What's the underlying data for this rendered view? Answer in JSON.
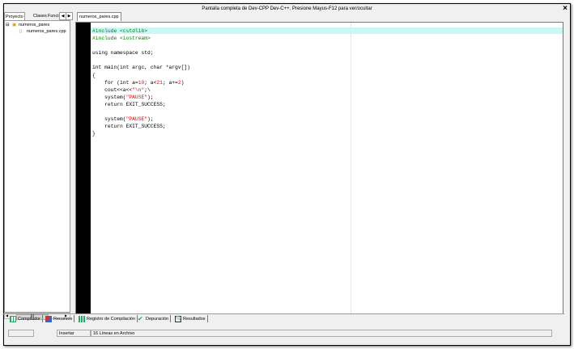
{
  "window": {
    "title": "Pantalla completa de Dev-CPP Dev-C++. Presione Mayus-F12 para ver/ocultar",
    "close": "×"
  },
  "left_panel": {
    "tabs": [
      "Proyecto",
      "Clases",
      "Funcic"
    ],
    "project_node": "numeros_pares",
    "file_node": "numeros_pares.cpp",
    "scroll_thumb_label": "III"
  },
  "editor": {
    "tab": "numeros_pares.cpp",
    "code": [
      [
        {
          "t": "#include <cstdlib>",
          "c": "pp"
        }
      ],
      [
        {
          "t": "#include <iostream>",
          "c": "pp"
        }
      ],
      [
        {
          "t": ""
        }
      ],
      [
        {
          "t": "using namespace std;"
        }
      ],
      [
        {
          "t": ""
        }
      ],
      [
        {
          "t": "int main(int argc, char *argv[])"
        }
      ],
      [
        {
          "t": "{"
        }
      ],
      [
        {
          "t": "    for (int a="
        },
        {
          "t": "10",
          "c": "num"
        },
        {
          "t": "; a<"
        },
        {
          "t": "21",
          "c": "num"
        },
        {
          "t": "; a+="
        },
        {
          "t": "2",
          "c": "num"
        },
        {
          "t": ")"
        }
      ],
      [
        {
          "t": "    cout<<a<<"
        },
        {
          "t": "\"\\n\"",
          "c": "str"
        },
        {
          "t": ";\\"
        }
      ],
      [
        {
          "t": "    system("
        },
        {
          "t": "\"PAUSE\"",
          "c": "str"
        },
        {
          "t": ");"
        }
      ],
      [
        {
          "t": "    return EXIT_SUCCESS;"
        }
      ],
      [
        {
          "t": ""
        }
      ],
      [
        {
          "t": "    system("
        },
        {
          "t": "\"PAUSE\"",
          "c": "str"
        },
        {
          "t": ");"
        }
      ],
      [
        {
          "t": "    return EXIT_SUCCESS;"
        }
      ],
      [
        {
          "t": "}"
        }
      ]
    ]
  },
  "bottom_tabs": {
    "compiler": "Compilador",
    "resources": "Recursos",
    "compile_log": "Registro de Compilación",
    "debug": "Depuración",
    "results": "Resultados"
  },
  "status": {
    "position": "",
    "mode": "Insertar",
    "lines": "16 Líneas en Archivo"
  }
}
